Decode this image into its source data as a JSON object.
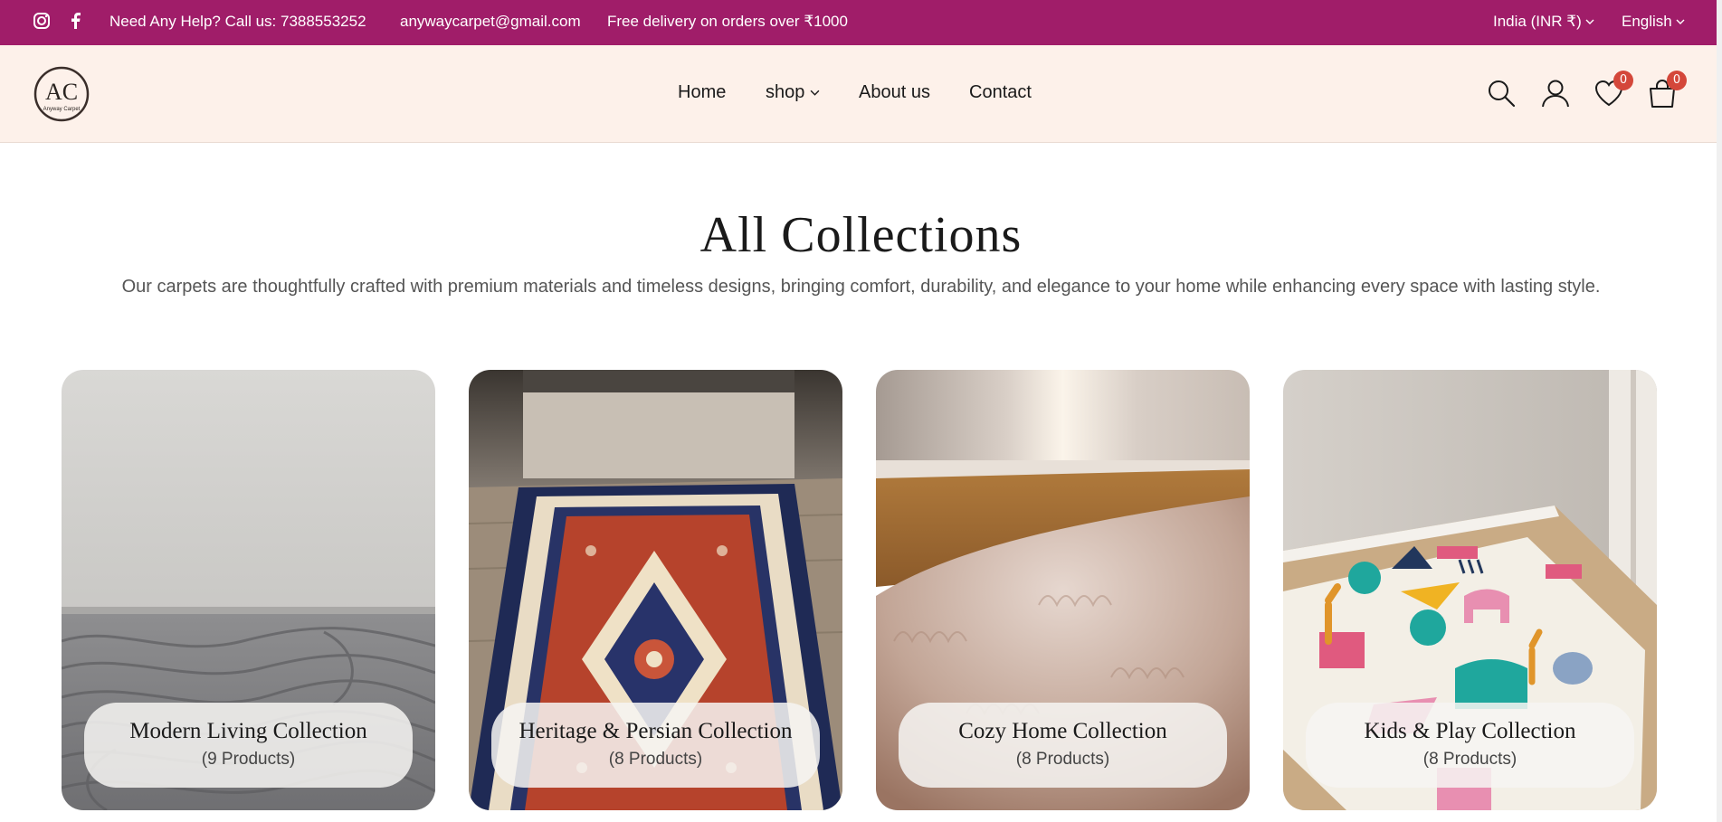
{
  "topbar": {
    "help_text": "Need Any Help? Call us: 7388553252",
    "email": "anywaycarpet@gmail.com",
    "delivery_text": "Free delivery on orders over ₹1000",
    "currency": "India (INR ₹)",
    "language": "English",
    "background_color": "#a01d69",
    "icons": [
      "instagram-icon",
      "facebook-icon"
    ]
  },
  "header": {
    "logo_text": "AC",
    "logo_subtext": "Anyway Carpet",
    "nav": {
      "home": "Home",
      "shop": "shop",
      "about": "About us",
      "contact": "Contact"
    },
    "wishlist_count": "0",
    "cart_count": "0",
    "background_color": "#fdf1ea"
  },
  "main": {
    "title": "All Collections",
    "subtitle": "Our carpets are thoughtfully crafted with premium materials and timeless designs, bringing comfort, durability, and elegance to your home while enhancing every space with lasting style.",
    "collections": [
      {
        "name": "Modern Living Collection",
        "count": "(9 Products)"
      },
      {
        "name": "Heritage & Persian Collection",
        "count": "(8 Products)"
      },
      {
        "name": "Cozy Home Collection",
        "count": "(8 Products)"
      },
      {
        "name": "Kids & Play Collection",
        "count": "(8 Products)"
      }
    ]
  },
  "colors": {
    "accent": "#a01d69",
    "badge": "#d4473a"
  }
}
